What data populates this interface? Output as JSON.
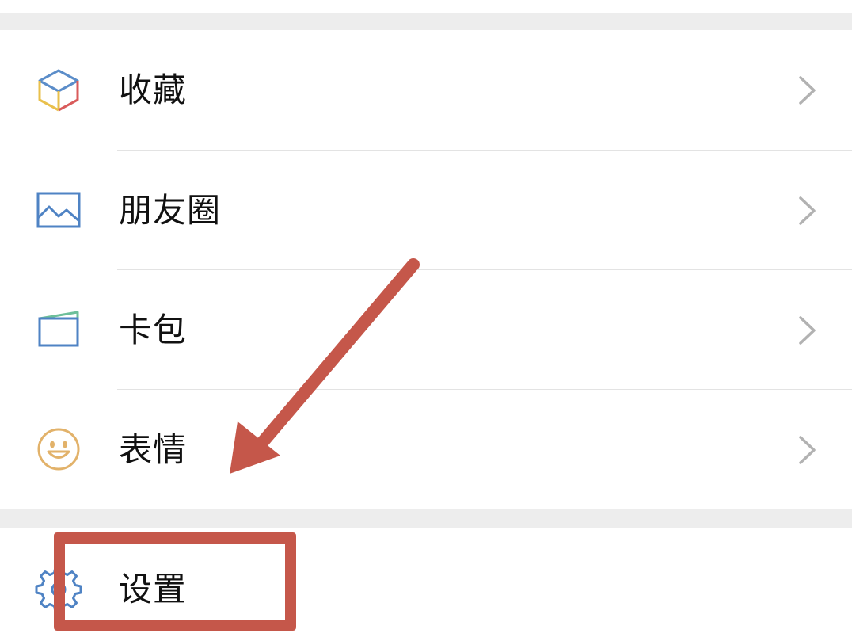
{
  "menu": {
    "items": [
      {
        "label": "收藏",
        "icon": "favorites-cube-icon"
      },
      {
        "label": "朋友圈",
        "icon": "moments-image-icon"
      },
      {
        "label": "卡包",
        "icon": "card-wallet-icon"
      },
      {
        "label": "表情",
        "icon": "emoji-smile-icon"
      }
    ],
    "settings": {
      "label": "设置",
      "icon": "gear-icon"
    }
  },
  "colors": {
    "background": "#ededed",
    "row_background": "#ffffff",
    "text": "#111111",
    "chevron": "#b2b2b2",
    "annotation": "#c5574a"
  }
}
